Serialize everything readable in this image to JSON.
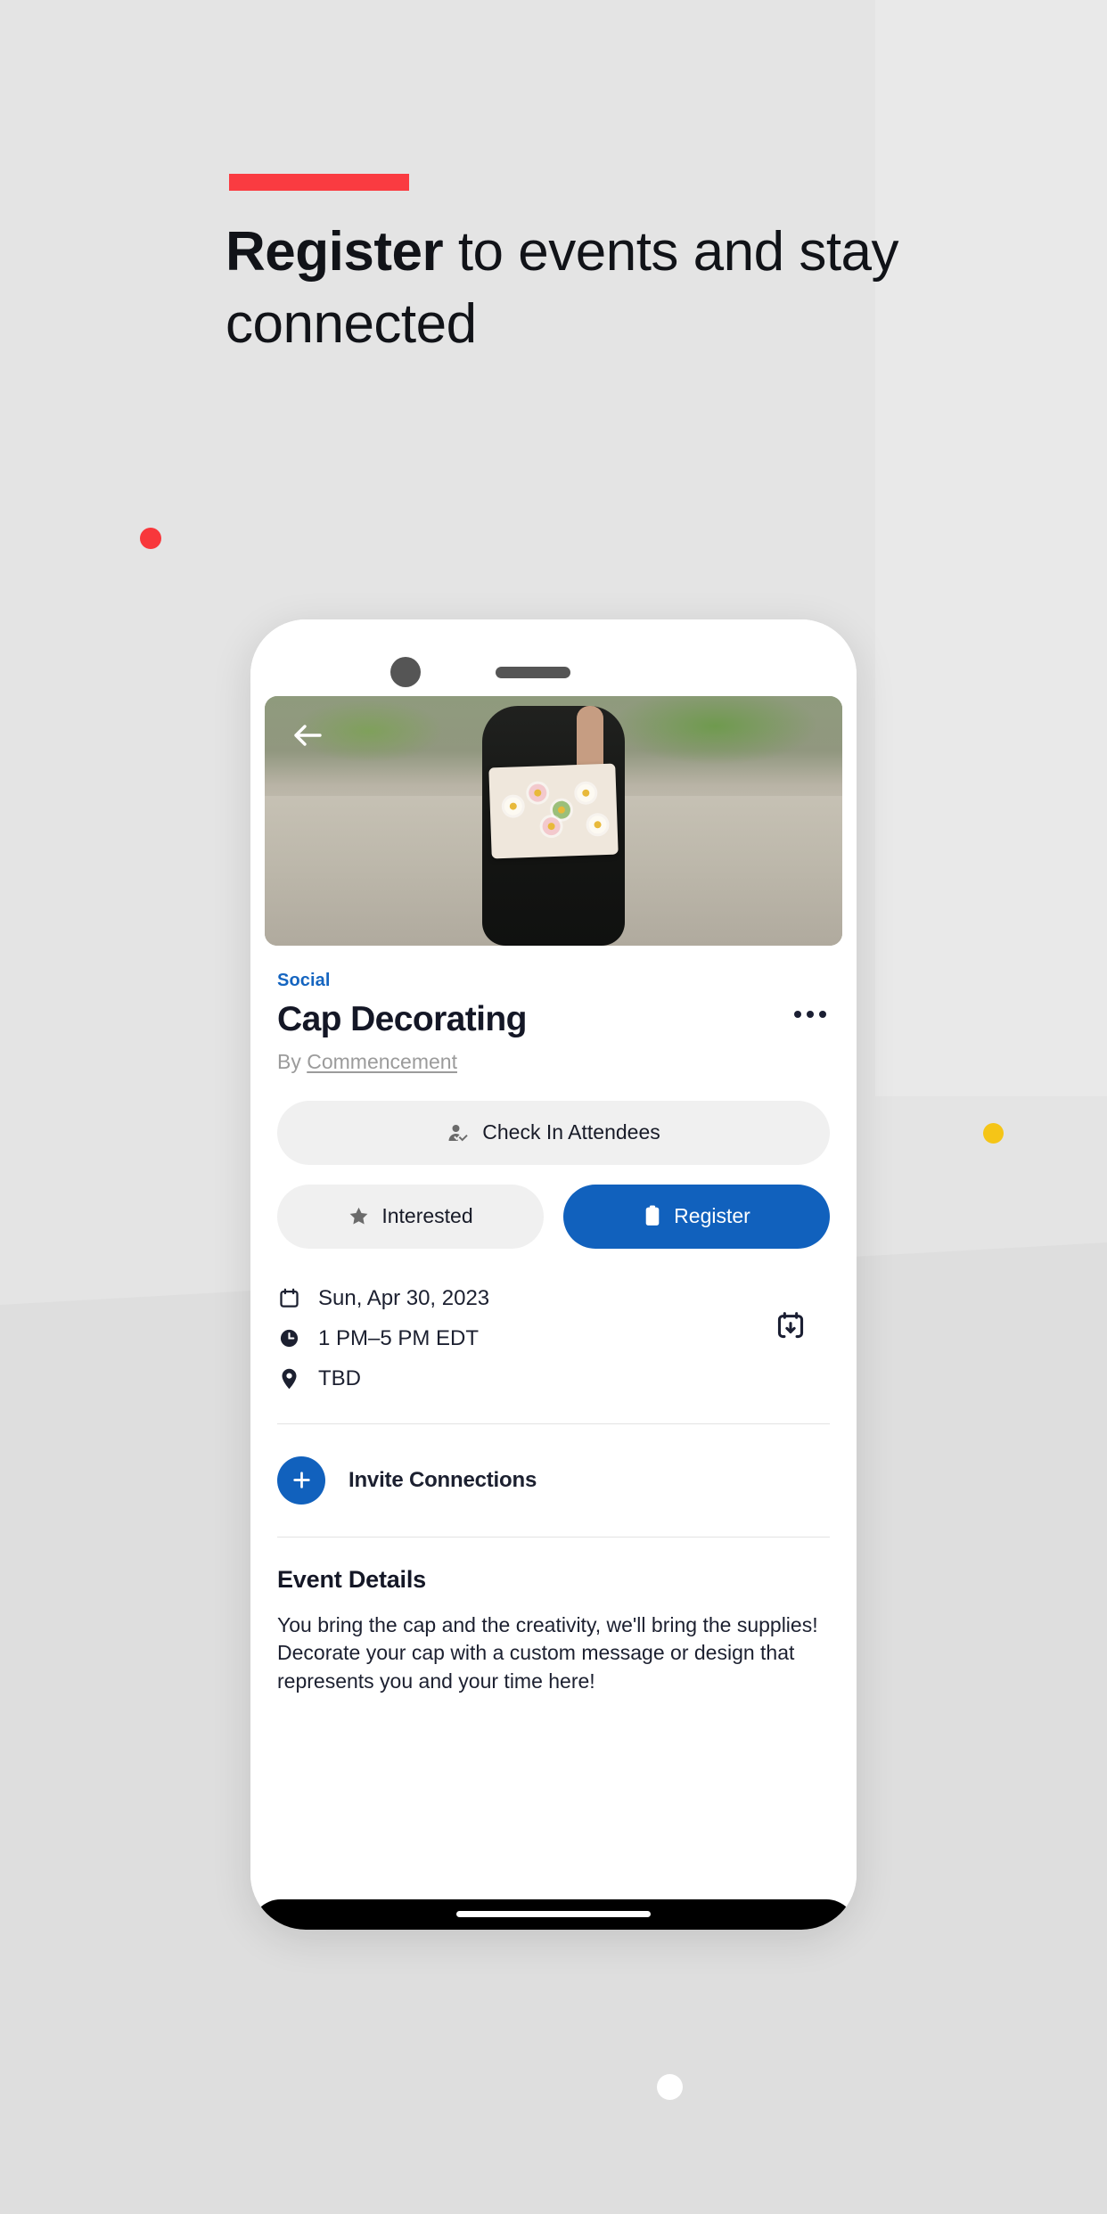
{
  "headline": {
    "bold_part": "Register",
    "rest_part": " to events and stay connected"
  },
  "phone": {
    "hero": {
      "back_icon": "back-arrow-icon",
      "alt": "Person in graduation gown holding a decorated cap"
    },
    "event": {
      "category": "Social",
      "title": "Cap Decorating",
      "by_prefix": "By ",
      "organizer": "Commencement",
      "more_icon": "kebab-menu-icon"
    },
    "actions": {
      "check_in_label": "Check In Attendees",
      "check_in_icon": "person-check-icon",
      "interested_label": "Interested",
      "interested_icon": "star-icon",
      "register_label": "Register",
      "register_icon": "clipboard-icon"
    },
    "meta": {
      "date": "Sun, Apr 30, 2023",
      "date_icon": "calendar-icon",
      "time": "1 PM–5 PM EDT",
      "time_icon": "clock-icon",
      "location": "TBD",
      "location_icon": "map-pin-icon",
      "add_to_calendar_icon": "calendar-download-icon"
    },
    "invite": {
      "label": "Invite Connections",
      "icon": "plus-icon"
    },
    "details": {
      "heading": "Event Details",
      "body": "You bring the cap and the creativity, we'll bring the supplies! Decorate your cap with a custom message or design that represents you and your time here!"
    }
  },
  "colors": {
    "accent_red": "#fa3b41",
    "accent_blue": "#1161bd",
    "category_blue": "#1565c0",
    "accent_yellow": "#f5c517",
    "page_bg": "#e4e4e4"
  }
}
